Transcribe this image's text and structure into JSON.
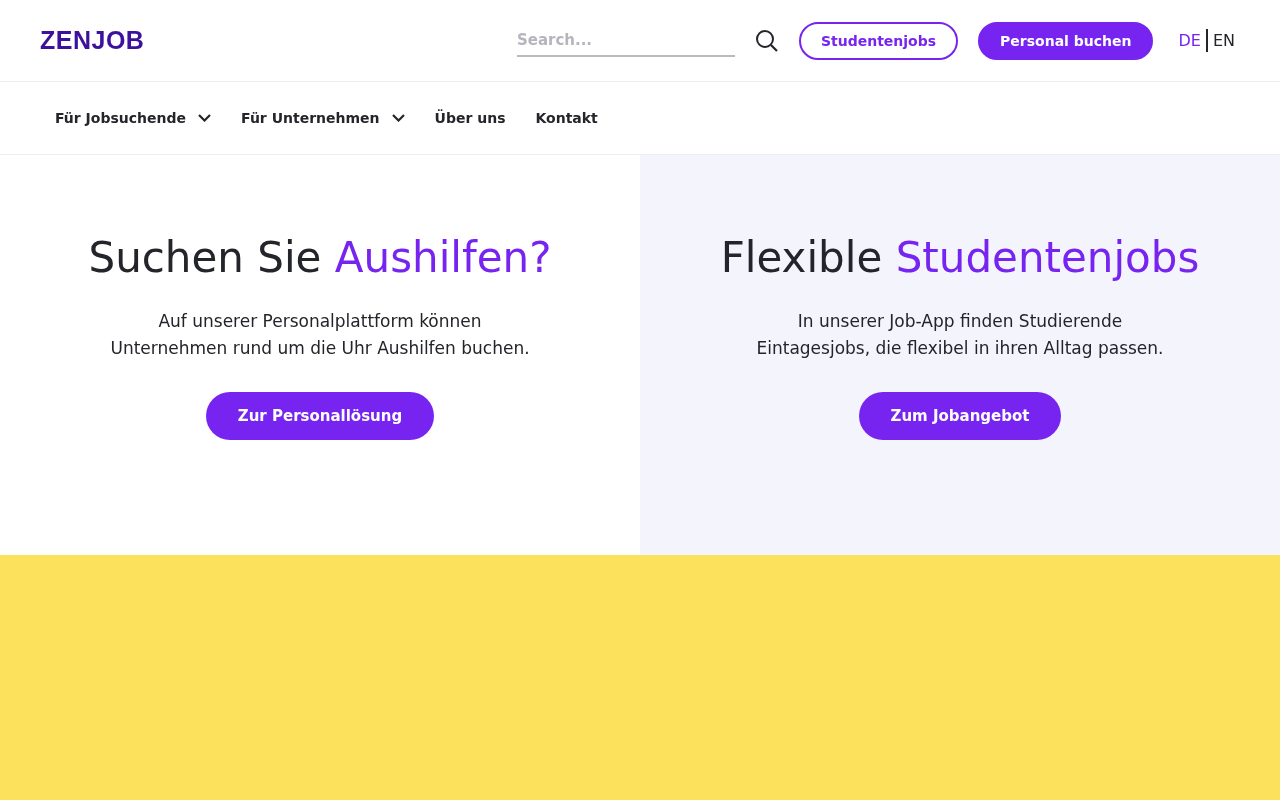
{
  "header": {
    "logo": "ZENJOB",
    "search": {
      "placeholder": "Search..."
    },
    "buttons": [
      {
        "label": "Studentenjobs",
        "kind": "outline"
      },
      {
        "label": "Personal buchen",
        "kind": "filled"
      }
    ],
    "languages": [
      {
        "label": "DE",
        "selected": true
      },
      {
        "label": "EN",
        "selected": false
      }
    ]
  },
  "nav": [
    {
      "label": "Für Jobsuchende",
      "dropdown": true
    },
    {
      "label": "Für Unternehmen",
      "dropdown": true
    },
    {
      "label": "Über uns",
      "dropdown": false
    },
    {
      "label": "Kontakt",
      "dropdown": false
    }
  ],
  "hero": [
    {
      "heading_lead": "Suchen Sie",
      "heading_accent": "Aushilfen?",
      "text": "Auf unserer Personalplattform können Unternehmen rund um die Uhr Aushilfen buchen.",
      "button": "Zur Personallösung",
      "color": "#ffffff"
    },
    {
      "heading_lead": "Flexible",
      "heading_accent": "Studentenjobs",
      "text": "In unserer Job-App finden Studierende Eintagesjobs, die flexibel in ihren Alltag passen.",
      "button": "Zum Jobangebot",
      "color": "#f4f4fd"
    }
  ]
}
